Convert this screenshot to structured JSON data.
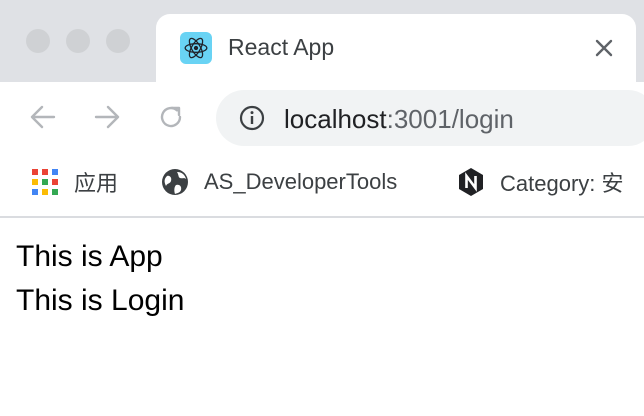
{
  "tab": {
    "title": "React App",
    "favicon": "react-logo-icon",
    "favicon_bg": "#69d3f4"
  },
  "toolbar": {
    "back_icon": "arrow-left-icon",
    "forward_icon": "arrow-right-icon",
    "reload_icon": "reload-icon"
  },
  "address": {
    "host": "localhost",
    "path": ":3001/login",
    "info_icon": "info-circle-icon"
  },
  "bookmarks": [
    {
      "label": "应用",
      "icon": "apps-grid-icon"
    },
    {
      "label": "AS_DeveloperTools",
      "icon": "globe-icon"
    },
    {
      "label": "Category: 安",
      "icon": "nuxt-n-icon"
    }
  ],
  "page": {
    "lines": [
      "This is App",
      "This is Login"
    ]
  }
}
